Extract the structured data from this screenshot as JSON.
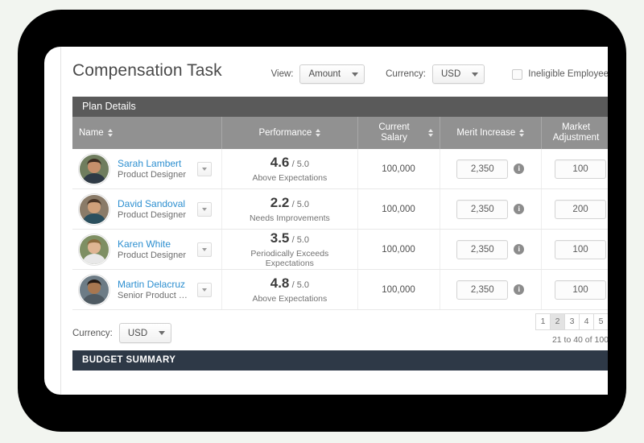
{
  "header": {
    "title": "Compensation Task",
    "view_label": "View:",
    "view_value": "Amount",
    "currency_label": "Currency:",
    "currency_value": "USD",
    "ineligible_label": "Ineligible Employee",
    "ineligible_checked": false
  },
  "section": {
    "plan_details_title": "Plan Details"
  },
  "table": {
    "columns": [
      {
        "label": "Name",
        "sortable": true
      },
      {
        "label": "Performance",
        "sortable": true
      },
      {
        "label": "Current Salary",
        "sortable": true
      },
      {
        "label": "Merit Increase",
        "sortable": true
      },
      {
        "label": "Market Adjustment",
        "sortable": true
      }
    ],
    "rows": [
      {
        "name": "Sarah Lambert",
        "role": "Product Designer",
        "score": "4.6",
        "score_max": "/ 5.0",
        "rating": "Above Expectations",
        "current_salary": "100,000",
        "merit_increase": "2,350",
        "market_adjustment": "100"
      },
      {
        "name": "David Sandoval",
        "role": "Product Designer",
        "score": "2.2",
        "score_max": "/ 5.0",
        "rating": "Needs Improvements",
        "current_salary": "100,000",
        "merit_increase": "2,350",
        "market_adjustment": "200"
      },
      {
        "name": "Karen White",
        "role": "Product Designer",
        "score": "3.5",
        "score_max": "/ 5.0",
        "rating": "Periodically Exceeds Expectations",
        "current_salary": "100,000",
        "merit_increase": "2,350",
        "market_adjustment": "100"
      },
      {
        "name": "Martin Delacruz",
        "role": "Senior Product Man...",
        "score": "4.8",
        "score_max": "/ 5.0",
        "rating": "Above Expectations",
        "current_salary": "100,000",
        "merit_increase": "2,350",
        "market_adjustment": "100"
      }
    ]
  },
  "footer": {
    "currency_label": "Currency:",
    "currency_value": "USD",
    "pages": [
      "1",
      "2",
      "3",
      "4",
      "5"
    ],
    "active_page": "2",
    "range_text": "21 to 40 of 100"
  },
  "budget": {
    "title": "BUDGET SUMMARY"
  },
  "colors": {
    "section_bar": "#5a5a5a",
    "table_header": "#919191",
    "budget_bar": "#2e3947",
    "link": "#2d8fd0",
    "bezel": "#000000",
    "page_bg": "#f2f5f0"
  }
}
